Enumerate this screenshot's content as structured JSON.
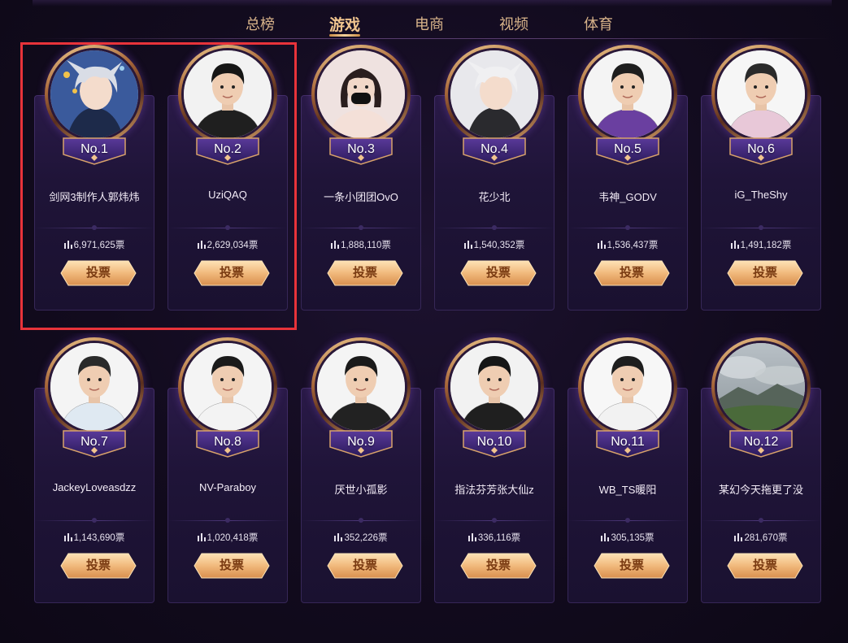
{
  "tabs": [
    {
      "label": "总榜",
      "active": false
    },
    {
      "label": "游戏",
      "active": true
    },
    {
      "label": "电商",
      "active": false
    },
    {
      "label": "视频",
      "active": false
    },
    {
      "label": "体育",
      "active": false
    }
  ],
  "vote_button_label": "投票",
  "vote_suffix": "票",
  "colors": {
    "accent_gold": "#f0c48e",
    "button_gold": "#e8b07a",
    "highlight_red": "#e8333a",
    "background": "#120b1e"
  },
  "cards": [
    {
      "rank": "No.1",
      "name": "剑网3制作人郭炜炜",
      "votes": "6,971,625票",
      "avatar": "anime-character"
    },
    {
      "rank": "No.2",
      "name": "UziQAQ",
      "votes": "2,629,034票",
      "avatar": "person"
    },
    {
      "rank": "No.3",
      "name": "一条小团团OvO",
      "votes": "1,888,110票",
      "avatar": "person-masked"
    },
    {
      "rank": "No.4",
      "name": "花少北",
      "votes": "1,540,352票",
      "avatar": "anime-character"
    },
    {
      "rank": "No.5",
      "name": "韦神_GODV",
      "votes": "1,536,437票",
      "avatar": "person"
    },
    {
      "rank": "No.6",
      "name": "iG_TheShy",
      "votes": "1,491,182票",
      "avatar": "person"
    },
    {
      "rank": "No.7",
      "name": "JackeyLoveasdzz",
      "votes": "1,143,690票",
      "avatar": "person"
    },
    {
      "rank": "No.8",
      "name": "NV-Paraboy",
      "votes": "1,020,418票",
      "avatar": "person"
    },
    {
      "rank": "No.9",
      "name": "厌世小孤影",
      "votes": "352,226票",
      "avatar": "person"
    },
    {
      "rank": "No.10",
      "name": "指法芬芳张大仙z",
      "votes": "336,116票",
      "avatar": "person"
    },
    {
      "rank": "No.11",
      "name": "WB_TS暖阳",
      "votes": "305,135票",
      "avatar": "person"
    },
    {
      "rank": "No.12",
      "name": "某幻今天拖更了没",
      "votes": "281,670票",
      "avatar": "landscape"
    }
  ]
}
